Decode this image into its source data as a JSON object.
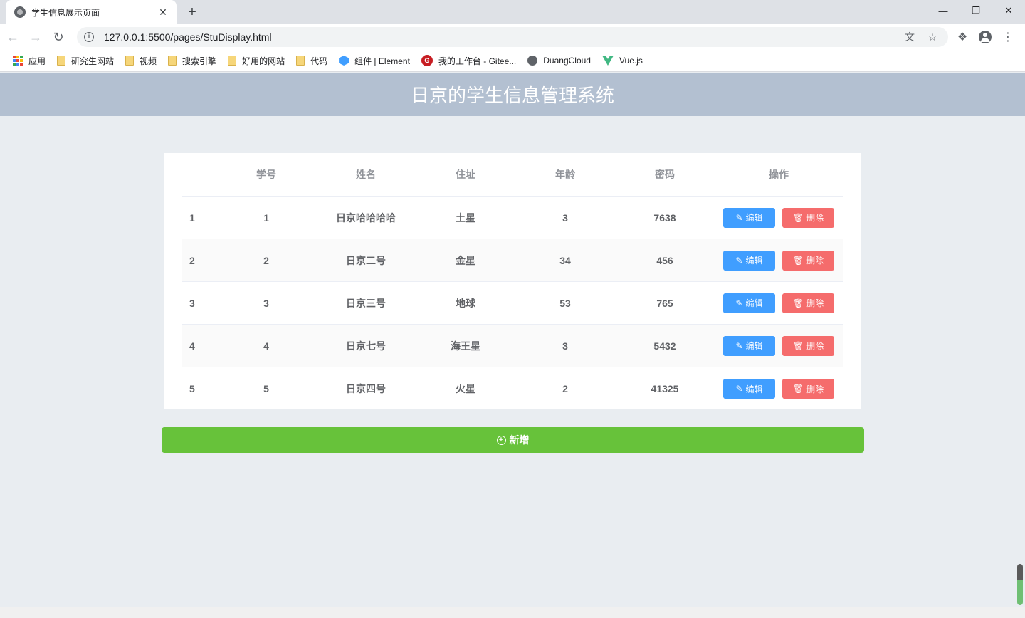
{
  "browser": {
    "tab_title": "学生信息展示页面",
    "tab_close": "✕",
    "new_tab": "+",
    "url": "127.0.0.1:5500/pages/StuDisplay.html",
    "bookmarks": [
      {
        "label": "应用",
        "icon": "apps-icon"
      },
      {
        "label": "研究生网站",
        "icon": "folder-icon"
      },
      {
        "label": "视频",
        "icon": "folder-icon"
      },
      {
        "label": "搜索引擎",
        "icon": "folder-icon"
      },
      {
        "label": "好用的网站",
        "icon": "folder-icon"
      },
      {
        "label": "代码",
        "icon": "folder-icon"
      },
      {
        "label": "组件 | Element",
        "icon": "element-icon"
      },
      {
        "label": "我的工作台 - Gitee...",
        "icon": "gitee-icon"
      },
      {
        "label": "DuangCloud",
        "icon": "globe-icon"
      },
      {
        "label": "Vue.js",
        "icon": "vue-icon"
      }
    ]
  },
  "header": {
    "title": "日京的学生信息管理系统"
  },
  "table": {
    "columns": [
      "",
      "学号",
      "姓名",
      "住址",
      "年龄",
      "密码",
      "操作"
    ],
    "rows": [
      {
        "index": "1",
        "id": "1",
        "name": "日京哈哈哈哈",
        "address": "土星",
        "age": "3",
        "password": "7638"
      },
      {
        "index": "2",
        "id": "2",
        "name": "日京二号",
        "address": "金星",
        "age": "34",
        "password": "456"
      },
      {
        "index": "3",
        "id": "3",
        "name": "日京三号",
        "address": "地球",
        "age": "53",
        "password": "765"
      },
      {
        "index": "4",
        "id": "4",
        "name": "日京七号",
        "address": "海王星",
        "age": "3",
        "password": "5432"
      },
      {
        "index": "5",
        "id": "5",
        "name": "日京四号",
        "address": "火星",
        "age": "2",
        "password": "41325"
      }
    ],
    "edit_label": "编辑",
    "delete_label": "删除"
  },
  "actions": {
    "add_label": "新增"
  },
  "colors": {
    "header_bg": "#b3c0d1",
    "page_bg": "#e9edf1",
    "edit": "#409eff",
    "delete": "#f56c6c",
    "add": "#67c23a"
  }
}
